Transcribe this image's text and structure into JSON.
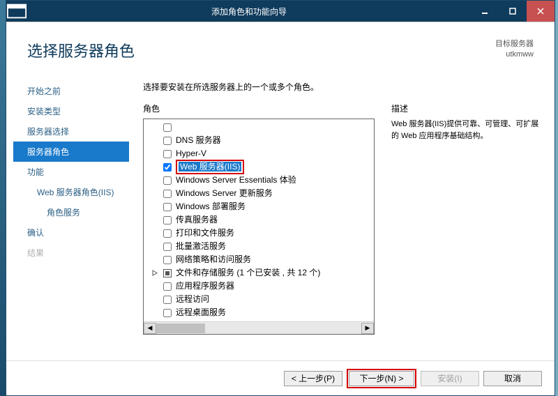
{
  "window": {
    "title": "添加角色和功能向导"
  },
  "page": {
    "heading": "选择服务器角色",
    "destination_label": "目标服务器",
    "destination_value": "utkmww"
  },
  "sidebar": {
    "steps": [
      {
        "label": "开始之前",
        "selected": false,
        "disabled": false
      },
      {
        "label": "安装类型",
        "selected": false,
        "disabled": false
      },
      {
        "label": "服务器选择",
        "selected": false,
        "disabled": false
      },
      {
        "label": "服务器角色",
        "selected": true,
        "disabled": false
      },
      {
        "label": "功能",
        "selected": false,
        "disabled": false
      },
      {
        "label": "Web 服务器角色(IIS)",
        "selected": false,
        "disabled": false,
        "sub": true
      },
      {
        "label": "角色服务",
        "selected": false,
        "disabled": false,
        "sub2": true
      },
      {
        "label": "确认",
        "selected": false,
        "disabled": false
      },
      {
        "label": "结果",
        "selected": false,
        "disabled": true
      }
    ]
  },
  "main": {
    "instruction": "选择要安装在所选服务器上的一个或多个角色。",
    "roles_label": "角色",
    "desc_label": "描述",
    "roles": [
      {
        "label": "DNS 服务器",
        "checked": false
      },
      {
        "label": "Hyper-V",
        "checked": false
      },
      {
        "label": "Web 服务器(IIS)",
        "checked": true,
        "highlight": true
      },
      {
        "label": "Windows Server Essentials 体验",
        "checked": false
      },
      {
        "label": "Windows Server 更新服务",
        "checked": false
      },
      {
        "label": "Windows 部署服务",
        "checked": false
      },
      {
        "label": "传真服务器",
        "checked": false
      },
      {
        "label": "打印和文件服务",
        "checked": false
      },
      {
        "label": "批量激活服务",
        "checked": false
      },
      {
        "label": "网络策略和访问服务",
        "checked": false
      },
      {
        "label": "文件和存储服务 (1 个已安装 , 共 12 个)",
        "checked": "partial",
        "expandable": true
      },
      {
        "label": "应用程序服务器",
        "checked": false
      },
      {
        "label": "远程访问",
        "checked": false
      },
      {
        "label": "远程桌面服务",
        "checked": false
      }
    ],
    "description": "Web 服务器(IIS)提供可靠、可管理、可扩展的 Web 应用程序基础结构。"
  },
  "footer": {
    "prev": "< 上一步(P)",
    "next": "下一步(N) >",
    "install": "安装(I)",
    "cancel": "取消"
  }
}
